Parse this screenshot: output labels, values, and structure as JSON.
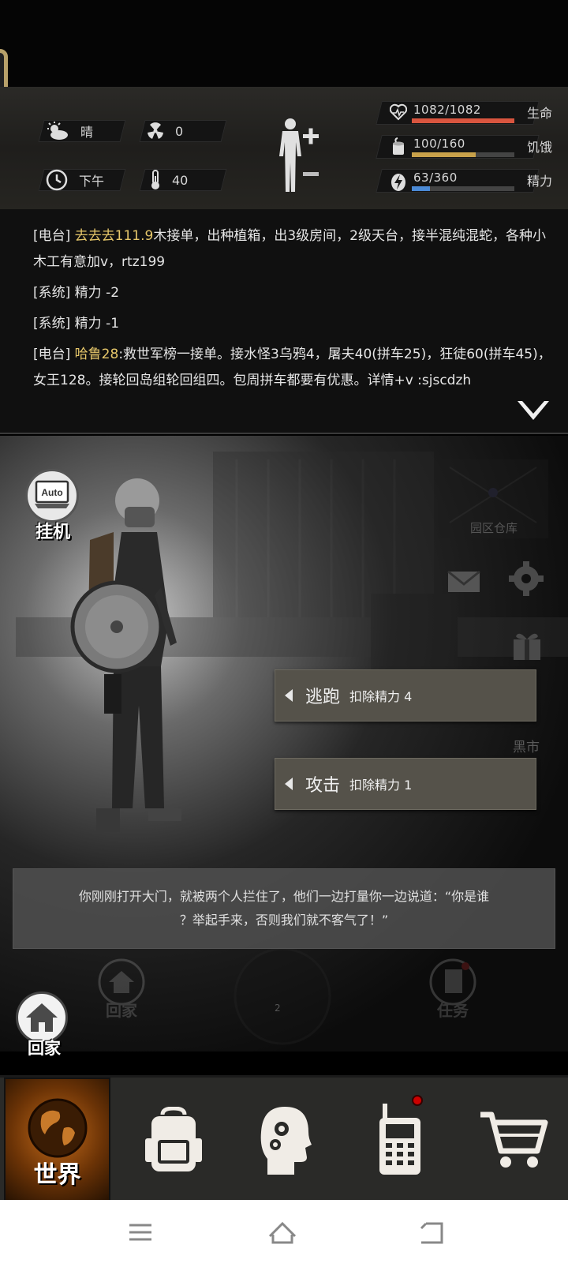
{
  "status": {
    "weather": "晴",
    "radiation": "0",
    "time": "下午",
    "temperature": "40",
    "life": {
      "value": "1082/1082",
      "label": "生命",
      "fill": 1.0,
      "color": "#d9553f"
    },
    "hunger": {
      "value": "100/160",
      "label": "饥饿",
      "fill": 0.625,
      "color": "#c8a14a"
    },
    "energy": {
      "value": "63/360",
      "label": "精力",
      "fill": 0.175,
      "color": "#4b8ad6"
    }
  },
  "log": [
    {
      "who": "[电台]",
      "name": "去去去111.9",
      "text": "木接单，出种植箱，出3级房间，2级天台，接半混纯混蛇，各种小木工有意加v，rtz199"
    },
    {
      "who": "[系统]",
      "name": "",
      "text": "精力 -2"
    },
    {
      "who": "[系统]",
      "name": "",
      "text": "精力 -1"
    },
    {
      "who": "[电台]",
      "name": "哈鲁28",
      "text": ":救世军榜一接单。接水怪3乌鸦4，屠夫40(拼车25)，狂徒60(拼车45)，女王128。接轮回岛组轮回组四。包周拼车都要有优惠。详情+v :sjscdzh"
    }
  ],
  "scene": {
    "auto_label": "挂机",
    "auto_icon_text": "Auto",
    "warehouse_label": "园区仓库",
    "market_label": "黑市",
    "home_label_faded": "回家",
    "task_label": "任务",
    "page_indicator": "2"
  },
  "actions": [
    {
      "name": "逃跑",
      "cost": "扣除精力 4"
    },
    {
      "name": "攻击",
      "cost": "扣除精力 1"
    }
  ],
  "dialog": {
    "line1": "你刚刚打开大门，就被两个人拦住了，他们一边打量你一边说道：“你是谁",
    "line2": "？举起手来，否则我们就不客气了！”"
  },
  "home_button": {
    "label": "回家"
  },
  "nav": {
    "world_label": "世界"
  }
}
